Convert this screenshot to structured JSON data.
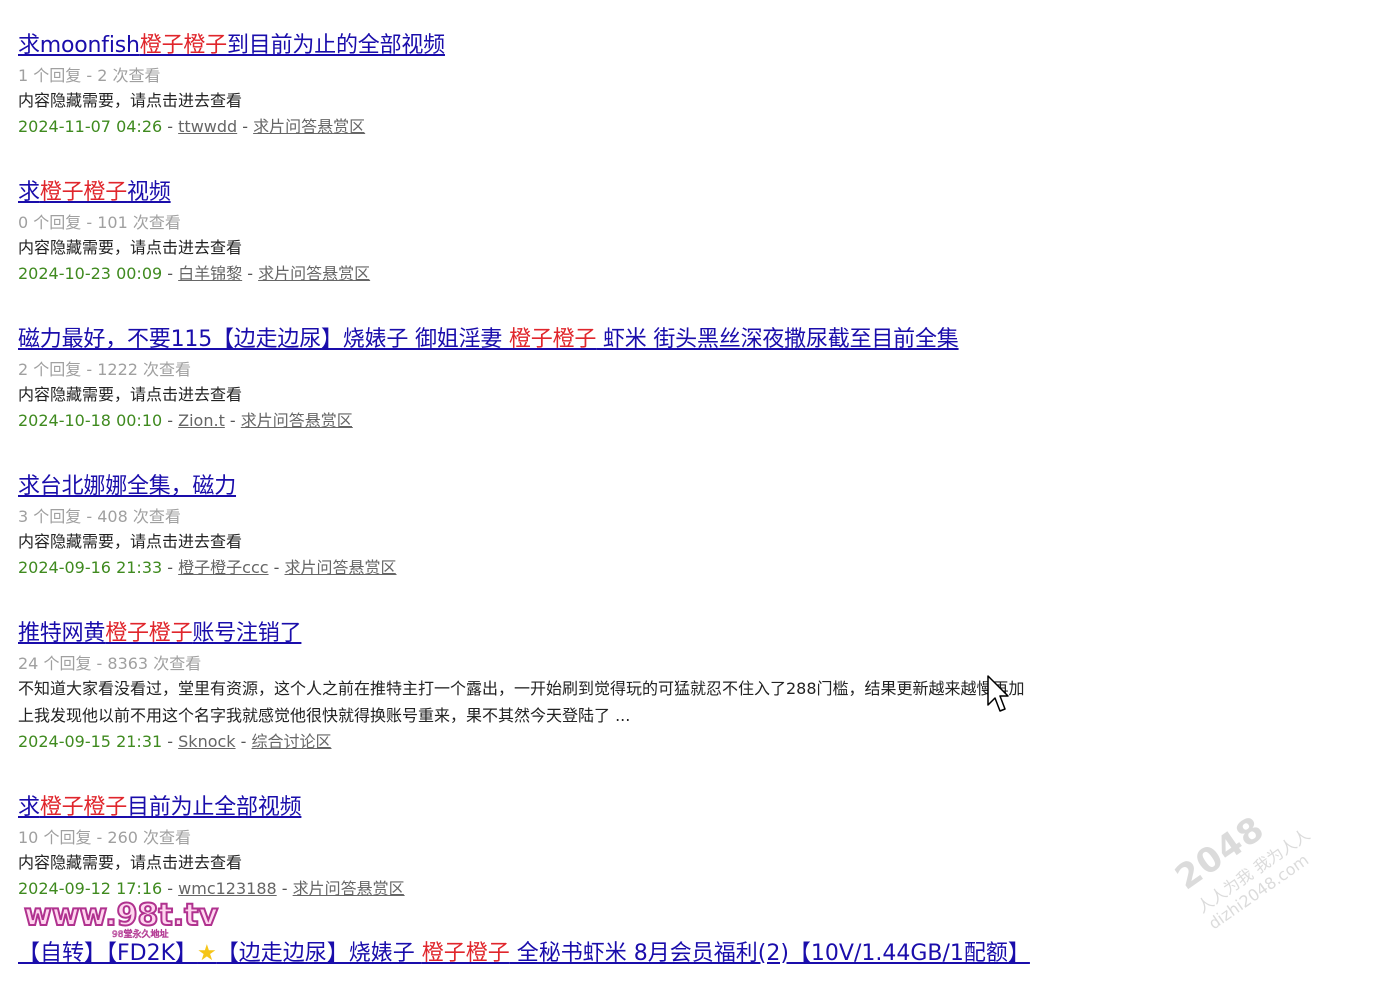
{
  "results": [
    {
      "title": {
        "pre": "求moonfish",
        "hl": "橙子橙子",
        "post": "到目前为止的全部视频"
      },
      "meta": "1 个回复 - 2 次查看",
      "snippet": "内容隐藏需要，请点击进去查看",
      "snippet2": "",
      "date": "2024-11-07 04:26",
      "author": "ttwwdd",
      "forum": "求片问答悬赏区"
    },
    {
      "title": {
        "pre": "求",
        "hl": "橙子橙子",
        "post": "视频"
      },
      "meta": "0 个回复 - 101 次查看",
      "snippet": "内容隐藏需要，请点击进去查看",
      "snippet2": "",
      "date": "2024-10-23 00:09",
      "author": "白羊锦黎",
      "forum": "求片问答悬赏区"
    },
    {
      "title": {
        "pre": "磁力最好，不要115【边走边尿】烧婊子 御姐淫妻 ",
        "hl": "橙子橙子",
        "post": " 虾米 街头黑丝深夜撒尿截至目前全集"
      },
      "meta": "2 个回复 - 1222 次查看",
      "snippet": "内容隐藏需要，请点击进去查看",
      "snippet2": "",
      "date": "2024-10-18 00:10",
      "author": "Zion.t",
      "forum": "求片问答悬赏区"
    },
    {
      "title": {
        "pre": "求台北娜娜全集，磁力",
        "hl": "",
        "post": ""
      },
      "meta": "3 个回复 - 408 次查看",
      "snippet": "内容隐藏需要，请点击进去查看",
      "snippet2": "",
      "date": "2024-09-16 21:33",
      "author": "橙子橙子ccc",
      "forum": "求片问答悬赏区"
    },
    {
      "title": {
        "pre": "推特网黄",
        "hl": "橙子橙子",
        "post": "账号注销了"
      },
      "meta": "24 个回复 - 8363 次查看",
      "snippet": "不知道大家看没看过，堂里有资源，这个人之前在推特主打一个露出，一开始刷到觉得玩的可猛就忍不住入了288门槛，结果更新越来越慢再加",
      "snippet2": "上我发现他以前不用这个名字我就感觉他很快就得换账号重来，果不其然今天登陆了 ...",
      "date": "2024-09-15 21:31",
      "author": "Sknock",
      "forum": "综合讨论区"
    },
    {
      "title": {
        "pre": "求",
        "hl": "橙子橙子",
        "post": "目前为止全部视频"
      },
      "meta": "10 个回复 - 260 次查看",
      "snippet": "内容隐藏需要，请点击进去查看",
      "snippet2": "",
      "date": "2024-09-12 17:16",
      "author": "wmc123188",
      "forum": "求片问答悬赏区"
    }
  ],
  "cut_title": {
    "pre": "【自转】【FD2K】",
    "mid": "【边走边尿】烧婊子 ",
    "hl": "橙子橙子",
    "post": " 全秘书虾米 8月会员福利(2)【10V/1.44GB/1配额】"
  },
  "watermark": {
    "big": "2048",
    "line1": "人人为我 我为人人",
    "line2": "dizhi2048.com"
  },
  "logo": {
    "text": "www.98t.tv",
    "sub": "98堂永久地址"
  },
  "colors": {
    "link": "#1a0dab",
    "highlight": "#e0262c",
    "date": "#3f8a1f",
    "meta": "#a0a0a0"
  }
}
